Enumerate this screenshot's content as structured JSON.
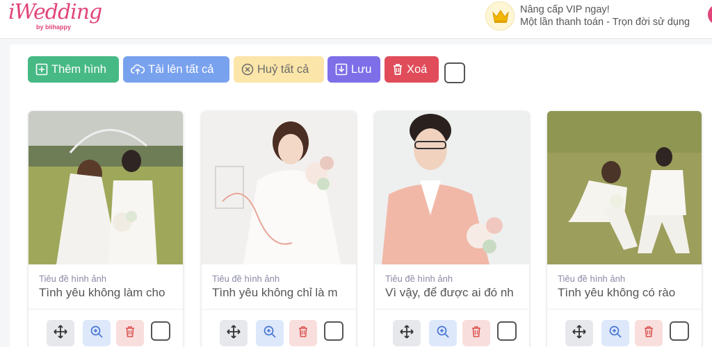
{
  "app": {
    "logo_text": "iWedding",
    "logo_sub": "by biihappy"
  },
  "vip": {
    "line1": "Nâng cấp VIP ngay!",
    "line2": "Một lần thanh toán - Trọn đời sử dụng"
  },
  "toolbar": {
    "add_label": "Thêm hình",
    "upload_label": "Tải lên tất cả",
    "cancel_label": "Huỷ tất cả",
    "save_label": "Lưu",
    "delete_label": "Xoá"
  },
  "cards": [
    {
      "caption_label": "Tiêu đề hình ảnh",
      "caption_value": "Tình yêu không làm cho"
    },
    {
      "caption_label": "Tiêu đề hình ảnh",
      "caption_value": "Tình yêu không chỉ là m"
    },
    {
      "caption_label": "Tiêu đề hình ảnh",
      "caption_value": "Vì vậy, để được ai đó nh"
    },
    {
      "caption_label": "Tiêu đề hình ảnh",
      "caption_value": "Tình yêu không có rào"
    }
  ],
  "colors": {
    "brand": "#e0447a",
    "add": "#47b985",
    "upload": "#79a2ee",
    "cancel": "#fbe5a8",
    "save": "#7e6ee8",
    "delete": "#e04c5a"
  },
  "icons": {
    "add": "plus-square-icon",
    "upload": "cloud-upload-icon",
    "cancel": "x-circle-icon",
    "save": "download-icon",
    "delete": "trash-icon",
    "move": "move-icon",
    "zoom": "zoom-in-icon",
    "vip": "crown-icon"
  }
}
